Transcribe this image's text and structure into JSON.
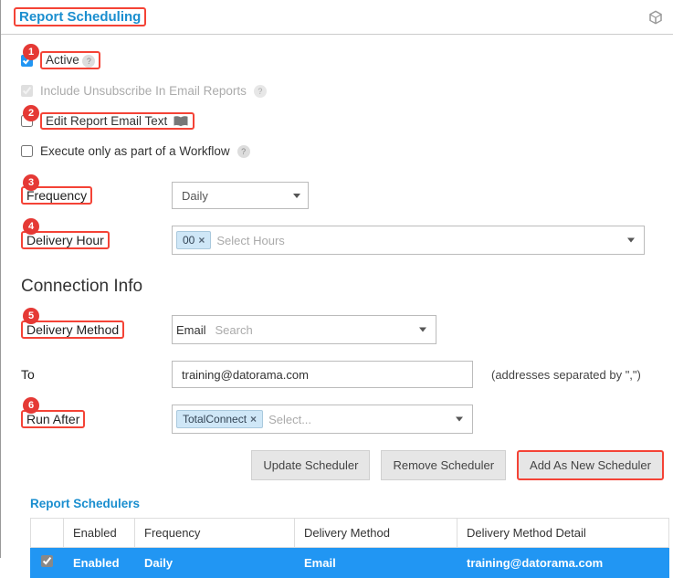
{
  "title": "Report Scheduling",
  "markers": [
    "1",
    "2",
    "3",
    "4",
    "5",
    "6"
  ],
  "checks": {
    "active": {
      "label": "Active",
      "checked": true,
      "help": true
    },
    "unsubscribe": {
      "label": "Include Unsubscribe In Email Reports",
      "checked": true,
      "help": true
    },
    "editEmail": {
      "label": "Edit Report Email Text",
      "checked": false,
      "book": true
    },
    "workflow": {
      "label": "Execute only as part of a Workflow",
      "checked": false,
      "help": true
    }
  },
  "frequency": {
    "label": "Frequency",
    "value": "Daily"
  },
  "deliveryHour": {
    "label": "Delivery Hour",
    "tag": "00",
    "placeholder": "Select Hours"
  },
  "section": "Connection Info",
  "deliveryMethod": {
    "label": "Delivery Method",
    "value": "Email",
    "placeholder": "Search"
  },
  "to": {
    "label": "To",
    "value": "training@datorama.com",
    "hint": "(addresses separated by \",\")"
  },
  "runAfter": {
    "label": "Run After",
    "tag": "TotalConnect",
    "placeholder": "Select..."
  },
  "buttons": {
    "update": "Update Scheduler",
    "remove": "Remove Scheduler",
    "addNew": "Add As New Scheduler"
  },
  "schedulers": {
    "title": "Report Schedulers",
    "headers": [
      "",
      "Enabled",
      "Frequency",
      "Delivery Method",
      "Delivery Method Detail"
    ],
    "rows": [
      {
        "checked": true,
        "enabled": "Enabled",
        "frequency": "Daily",
        "method": "Email",
        "detail": "training@datorama.com"
      }
    ]
  }
}
